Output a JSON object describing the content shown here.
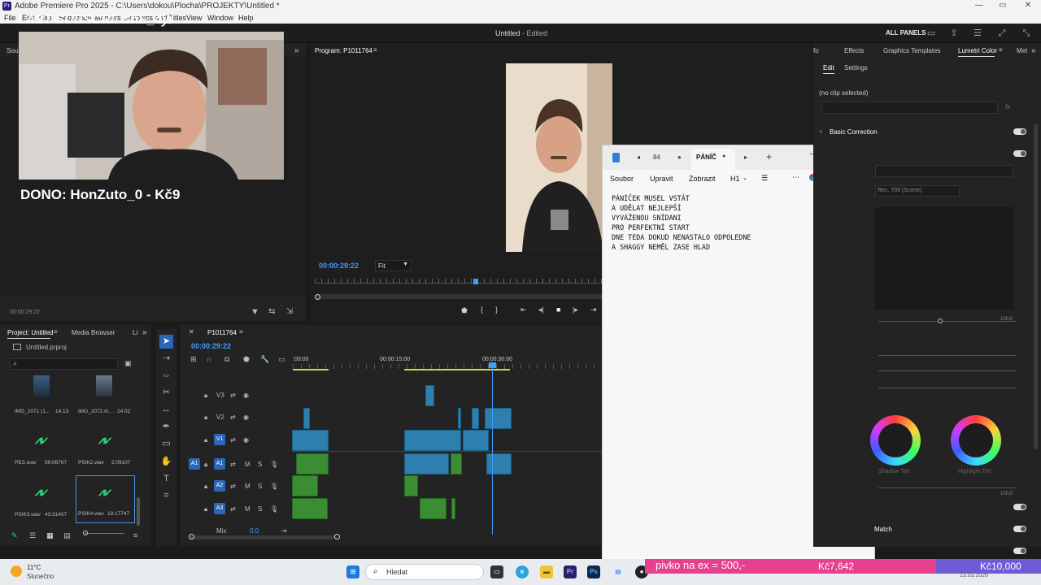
{
  "window": {
    "title": "Adobe Premiere Pro 2025 - C:\\Users\\dokou\\Plocha\\PROJEKTY\\Untitled *",
    "app_icon": "Pr",
    "minimize": "—",
    "restore": "▭",
    "close": "✕"
  },
  "menu": [
    "File",
    "Edit",
    "Clip",
    "Sequence",
    "Markers",
    "Graphics and Titles",
    "View",
    "Window",
    "Help"
  ],
  "header": {
    "document_title": "Untitled",
    "document_status": "- Edited",
    "all_panels": "ALL PANELS"
  },
  "stream_overlay": {
    "last_subscriber": "LAST SUBSCRI: ShE_4y/",
    "donation": "DONO: HonZuto_0 - Kč9",
    "goal_text": "pivko na ex = 500,-",
    "goal_current": "Kč7,642",
    "goal_total": "Kč10,000"
  },
  "source_panel": {
    "tab": "Sou",
    "timecode": "00:00:29:22"
  },
  "program_monitor": {
    "title": "Program: P1011764",
    "timecode": "00:00:29:22",
    "zoom": "Fit"
  },
  "notepad": {
    "tab_prev": "84",
    "tab_active": "PÁNÍČ",
    "add_tab": "+",
    "menus": [
      "Soubor",
      "Upravit",
      "Zobrazit"
    ],
    "heading": "H1",
    "text": "PÁNÍČEK MUSEL VSTÁT\nA UDĚLAT NEJLEPŠÍ\nVYVÁŽENOU SNÍDANI\nPRO PERFEKTNÍ START\nDNE TEDA DOKUD NENASTALO ODPOLEDNE\nA SHAGGY NEMĚL ZASE HLAD"
  },
  "project_panel": {
    "tabs": [
      "Project: Untitled",
      "Media Browser",
      "Li"
    ],
    "file": "Untitled.prproj",
    "search_placeholder": "",
    "items": [
      {
        "name": "IMG_2071 (1...",
        "duration": "14:13",
        "kind": "video"
      },
      {
        "name": "IMG_2072.m...",
        "duration": "24:02",
        "kind": "video"
      },
      {
        "name": "PES.wav",
        "duration": "59:06767",
        "kind": "audio"
      },
      {
        "name": "PSIK2.wav",
        "duration": "2:09107",
        "kind": "audio"
      },
      {
        "name": "PSIK3.wav",
        "duration": "43:31407",
        "kind": "audio"
      },
      {
        "name": "PSIK4.wav",
        "duration": "18:17747",
        "kind": "audio"
      }
    ]
  },
  "timeline": {
    "sequence": "P1011764",
    "timecode": "00:00:29:22",
    "ruler": [
      ":00:00",
      "00:00:15:00",
      "00:00:30:00"
    ],
    "tracks": [
      {
        "id": "V3",
        "type": "video"
      },
      {
        "id": "V2",
        "type": "video"
      },
      {
        "id": "V1",
        "type": "video"
      },
      {
        "id": "A1",
        "type": "audio"
      },
      {
        "id": "A2",
        "type": "audio"
      },
      {
        "id": "A3",
        "type": "audio"
      }
    ],
    "mix_label": "Mix",
    "mix_value": "0.0",
    "source_patch": "A1"
  },
  "lumetri": {
    "tabs": [
      "fo",
      "Effects",
      "Graphics Templates",
      "Lumetri Color",
      "Met"
    ],
    "subtabs": [
      "Edit",
      "Settings"
    ],
    "no_clip": "(no clip selected)",
    "fx": "fx",
    "basic_correction": "Basic Correction",
    "color_space": "Rec. 709 (Scene)",
    "shadow_tint": "Shadow Tint",
    "highlight_tint": "Highlight Tint",
    "slider_max_1": "100,0",
    "slider_max_2": "100,0",
    "match": "Match"
  },
  "taskbar": {
    "temperature": "11°C",
    "weather": "Slunečno",
    "search_placeholder": "Hledat",
    "date": "13.03.2026"
  },
  "colors": {
    "accent_blue": "#2a67b8",
    "playhead": "#3f9dff",
    "audio_clip": "#3b8d34",
    "video_clip": "#2f7fae",
    "donation_bar": "#e6408e",
    "goal_bar": "#6f5bd6"
  }
}
